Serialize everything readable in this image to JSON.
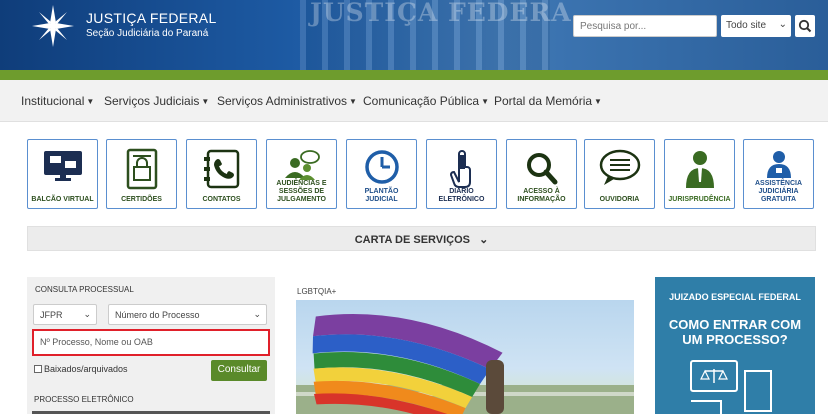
{
  "header": {
    "brand_title": "JUSTIÇA FEDERAL",
    "brand_subtitle": "Seção Judiciária do Paraná",
    "building_text": "JUSTIÇA FEDERA",
    "search_placeholder": "Pesquisa por...",
    "search_scope": "Todo site",
    "colors": {
      "header_blue": "#1d5aa3",
      "green_bar": "#6e9c2d"
    }
  },
  "nav": {
    "items": [
      {
        "label": "Institucional"
      },
      {
        "label": "Serviços Judiciais"
      },
      {
        "label": "Serviços Administrativos"
      },
      {
        "label": "Comunicação Pública"
      },
      {
        "label": "Portal da Memória"
      }
    ]
  },
  "tiles": [
    {
      "label": "BALCÃO VIRTUAL",
      "icon": "virtual-desk-icon"
    },
    {
      "label": "CERTIDÕES",
      "icon": "certificate-icon"
    },
    {
      "label": "CONTATOS",
      "icon": "phone-contacts-icon"
    },
    {
      "label": "AUDIÊNCIAS E SESSÕES DE JULGAMENTO",
      "icon": "hearing-chat-icon"
    },
    {
      "label": "PLANTÃO JUDICIAL",
      "icon": "clock-icon"
    },
    {
      "label": "DIÁRIO ELETRÔNICO",
      "icon": "touch-hand-icon"
    },
    {
      "label": "ACESSO À INFORMAÇÃO",
      "icon": "magnifier-icon"
    },
    {
      "label": "OUVIDORIA",
      "icon": "speech-bubble-icon"
    },
    {
      "label": "JURISPRUDÊNCIA",
      "icon": "judge-icon"
    },
    {
      "label": "ASSISTÊNCIA JUDICIÁRIA GRATUITA",
      "icon": "assistance-person-icon"
    }
  ],
  "carta": {
    "label": "CARTA DE SERVIÇOS"
  },
  "consulta": {
    "title": "CONSULTA PROCESSUAL",
    "uf_select": "JFPR",
    "type_select": "Número do Processo",
    "input_placeholder": "Nº Processo, Nome ou OAB",
    "checkbox_label": "Baixados/arquivados",
    "button_label": "Consultar",
    "pe_title": "PROCESSO ELETRÔNICO"
  },
  "news": {
    "tag": "LGBTQIA+"
  },
  "jef": {
    "title": "JUIZADO ESPECIAL FEDERAL",
    "question_line1": "COMO ENTRAR COM",
    "question_line2": "UM PROCESSO?"
  }
}
